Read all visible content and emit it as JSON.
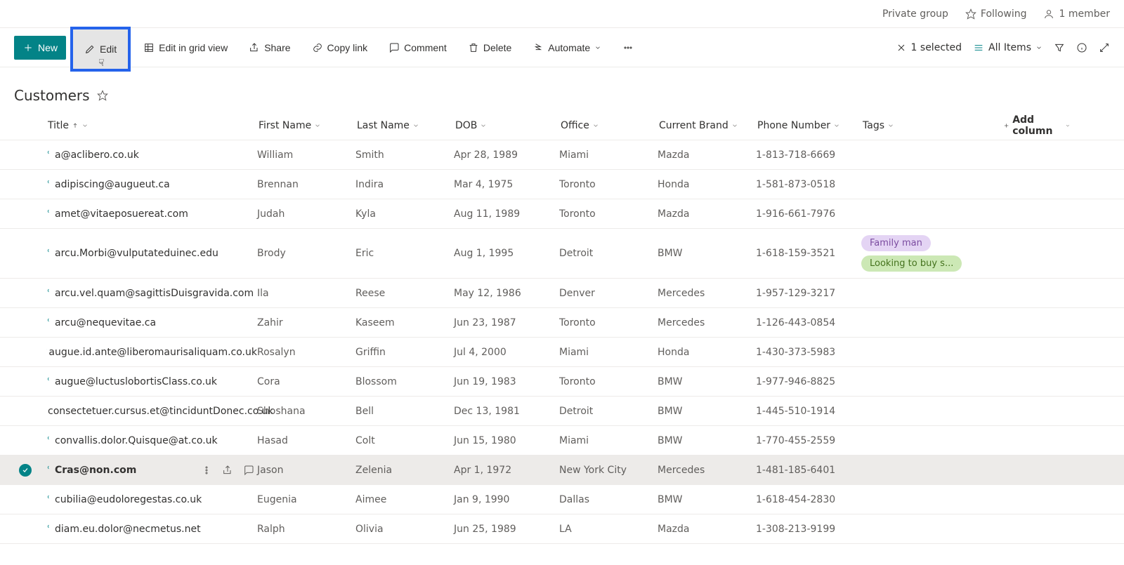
{
  "infobar": {
    "group_type": "Private group",
    "following_label": "Following",
    "members_label": "1 member"
  },
  "toolbar": {
    "new_label": "New",
    "edit_label": "Edit",
    "edit_grid_label": "Edit in grid view",
    "share_label": "Share",
    "copy_link_label": "Copy link",
    "comment_label": "Comment",
    "delete_label": "Delete",
    "automate_label": "Automate",
    "selected_label": "1 selected",
    "all_items_label": "All Items"
  },
  "title": "Customers",
  "columns": {
    "title": "Title",
    "first_name": "First Name",
    "last_name": "Last Name",
    "dob": "DOB",
    "office": "Office",
    "brand": "Current Brand",
    "phone": "Phone Number",
    "tags": "Tags",
    "add": "Add column"
  },
  "tags_colors": {
    "Family man": "purple",
    "Looking to buy s...": "green"
  },
  "rows": [
    {
      "title": "a@aclibero.co.uk",
      "first": "William",
      "last": "Smith",
      "dob": "Apr 28, 1989",
      "office": "Miami",
      "brand": "Mazda",
      "phone": "1-813-718-6669",
      "tags": [],
      "selected": false
    },
    {
      "title": "adipiscing@augueut.ca",
      "first": "Brennan",
      "last": "Indira",
      "dob": "Mar 4, 1975",
      "office": "Toronto",
      "brand": "Honda",
      "phone": "1-581-873-0518",
      "tags": [],
      "selected": false
    },
    {
      "title": "amet@vitaeposuereat.com",
      "first": "Judah",
      "last": "Kyla",
      "dob": "Aug 11, 1989",
      "office": "Toronto",
      "brand": "Mazda",
      "phone": "1-916-661-7976",
      "tags": [],
      "selected": false
    },
    {
      "title": "arcu.Morbi@vulputateduinec.edu",
      "first": "Brody",
      "last": "Eric",
      "dob": "Aug 1, 1995",
      "office": "Detroit",
      "brand": "BMW",
      "phone": "1-618-159-3521",
      "tags": [
        "Family man",
        "Looking to buy s..."
      ],
      "selected": false
    },
    {
      "title": "arcu.vel.quam@sagittisDuisgravida.com",
      "first": "Ila",
      "last": "Reese",
      "dob": "May 12, 1986",
      "office": "Denver",
      "brand": "Mercedes",
      "phone": "1-957-129-3217",
      "tags": [],
      "selected": false
    },
    {
      "title": "arcu@nequevitae.ca",
      "first": "Zahir",
      "last": "Kaseem",
      "dob": "Jun 23, 1987",
      "office": "Toronto",
      "brand": "Mercedes",
      "phone": "1-126-443-0854",
      "tags": [],
      "selected": false
    },
    {
      "title": "augue.id.ante@liberomaurisaliquam.co.uk",
      "first": "Rosalyn",
      "last": "Griffin",
      "dob": "Jul 4, 2000",
      "office": "Miami",
      "brand": "Honda",
      "phone": "1-430-373-5983",
      "tags": [],
      "selected": false
    },
    {
      "title": "augue@luctuslobortisClass.co.uk",
      "first": "Cora",
      "last": "Blossom",
      "dob": "Jun 19, 1983",
      "office": "Toronto",
      "brand": "BMW",
      "phone": "1-977-946-8825",
      "tags": [],
      "selected": false
    },
    {
      "title": "consectetuer.cursus.et@tinciduntDonec.co.uk",
      "first": "Shoshana",
      "last": "Bell",
      "dob": "Dec 13, 1981",
      "office": "Detroit",
      "brand": "BMW",
      "phone": "1-445-510-1914",
      "tags": [],
      "selected": false
    },
    {
      "title": "convallis.dolor.Quisque@at.co.uk",
      "first": "Hasad",
      "last": "Colt",
      "dob": "Jun 15, 1980",
      "office": "Miami",
      "brand": "BMW",
      "phone": "1-770-455-2559",
      "tags": [],
      "selected": false
    },
    {
      "title": "Cras@non.com",
      "first": "Jason",
      "last": "Zelenia",
      "dob": "Apr 1, 1972",
      "office": "New York City",
      "brand": "Mercedes",
      "phone": "1-481-185-6401",
      "tags": [],
      "selected": true
    },
    {
      "title": "cubilia@eudoloregestas.co.uk",
      "first": "Eugenia",
      "last": "Aimee",
      "dob": "Jan 9, 1990",
      "office": "Dallas",
      "brand": "BMW",
      "phone": "1-618-454-2830",
      "tags": [],
      "selected": false
    },
    {
      "title": "diam.eu.dolor@necmetus.net",
      "first": "Ralph",
      "last": "Olivia",
      "dob": "Jun 25, 1989",
      "office": "LA",
      "brand": "Mazda",
      "phone": "1-308-213-9199",
      "tags": [],
      "selected": false
    }
  ]
}
